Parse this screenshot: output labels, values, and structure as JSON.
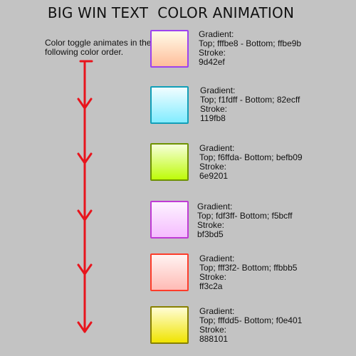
{
  "title": "BIG WIN TEXT  COLOR ANIMATION",
  "intro": "Color toggle animates in the following color order.",
  "arrow_color": "#e8141c",
  "swatches": [
    {
      "label": "Gradient:",
      "gradient": "Top; fffbe8 - Bottom; ffbe9b",
      "stroke_label": "Stroke:",
      "stroke": "9d42ef",
      "top_color": "#fffbe8",
      "bottom_color": "#ffbe9b",
      "stroke_color": "#9d42ef"
    },
    {
      "label": "Gradient:",
      "gradient": "Top; f1fdff - Bottom; 82ecff",
      "stroke_label": "Stroke:",
      "stroke": "119fb8",
      "top_color": "#f1fdff",
      "bottom_color": "#82ecff",
      "stroke_color": "#119fb8"
    },
    {
      "label": "Gradient:",
      "gradient": "Top; f6ffda- Bottom; befb09",
      "stroke_label": "Stroke:",
      "stroke": "6e9201",
      "top_color": "#f6ffda",
      "bottom_color": "#befb09",
      "stroke_color": "#6e9201"
    },
    {
      "label": "Gradient:",
      "gradient": "Top; fdf3ff- Bottom; f5bcff",
      "stroke_label": "Stroke:",
      "stroke": "bf3bd5",
      "top_color": "#fdf3ff",
      "bottom_color": "#f5bcff",
      "stroke_color": "#bf3bd5"
    },
    {
      "label": "Gradient:",
      "gradient": "Top; fff3f2- Bottom; ffbbb5",
      "stroke_label": "Stroke:",
      "stroke": "ff3c2a",
      "top_color": "#fff3f2",
      "bottom_color": "#ffbbb5",
      "stroke_color": "#ff3c2a"
    },
    {
      "label": "Gradient:",
      "gradient": "Top; fffdd5- Bottom; f0e401",
      "stroke_label": "Stroke:",
      "stroke": "888101",
      "top_color": "#fffdd5",
      "bottom_color": "#f0e401",
      "stroke_color": "#888101"
    }
  ]
}
